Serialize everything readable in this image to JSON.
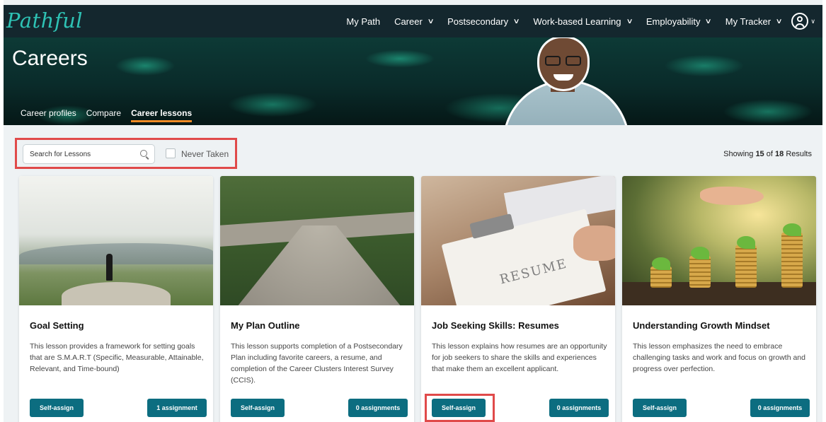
{
  "brand": {
    "logo_text": "Pathful",
    "accent": "#2ec3b5"
  },
  "nav": {
    "items": [
      {
        "label": "My Path",
        "has_dropdown": false
      },
      {
        "label": "Career",
        "has_dropdown": true
      },
      {
        "label": "Postsecondary",
        "has_dropdown": true
      },
      {
        "label": "Work-based Learning",
        "has_dropdown": true
      },
      {
        "label": "Employability",
        "has_dropdown": true
      },
      {
        "label": "My Tracker",
        "has_dropdown": true
      }
    ],
    "chevron_glyph": "⌄",
    "avatar_icon": "user-circle-icon"
  },
  "hero": {
    "title": "Careers",
    "subtabs": [
      {
        "label": "Career profiles",
        "active": false
      },
      {
        "label": "Compare",
        "active": false
      },
      {
        "label": "Career lessons",
        "active": true
      }
    ]
  },
  "filters": {
    "search_placeholder": "Search for Lessons",
    "never_taken_label": "Never Taken",
    "never_taken_checked": false
  },
  "results": {
    "prefix": "Showing",
    "shown": "15",
    "middle": "of",
    "total": "18",
    "suffix": "Results"
  },
  "cards": [
    {
      "title": "Goal Setting",
      "description": "This lesson provides a framework for setting goals that are S.M.A.R.T (Specific, Measurable, Attainable, Relevant, and Time-bound)",
      "self_assign_label": "Self-assign",
      "assignments_label": "1 assignment"
    },
    {
      "title": "My Plan Outline",
      "description": "This lesson supports completion of a Postsecondary Plan including favorite careers, a resume, and completion of the Career Clusters Interest Survey (CCIS).",
      "self_assign_label": "Self-assign",
      "assignments_label": "0 assignments"
    },
    {
      "title": "Job Seeking Skills: Resumes",
      "description": "This lesson explains how resumes are an opportunity for job seekers to share the skills and experiences that make them an excellent applicant.",
      "self_assign_label": "Self-assign",
      "assignments_label": "0 assignments",
      "image_text": "RESUME"
    },
    {
      "title": "Understanding Growth Mindset",
      "description": "This lesson emphasizes the need to embrace challenging tasks and work and focus on growth and progress over perfection.",
      "self_assign_label": "Self-assign",
      "assignments_label": "0 assignments"
    }
  ],
  "colors": {
    "nav_bg": "#14272e",
    "button": "#0c6d80",
    "highlight": "#e04a4a",
    "active_tab_underline": "#f08a24"
  }
}
